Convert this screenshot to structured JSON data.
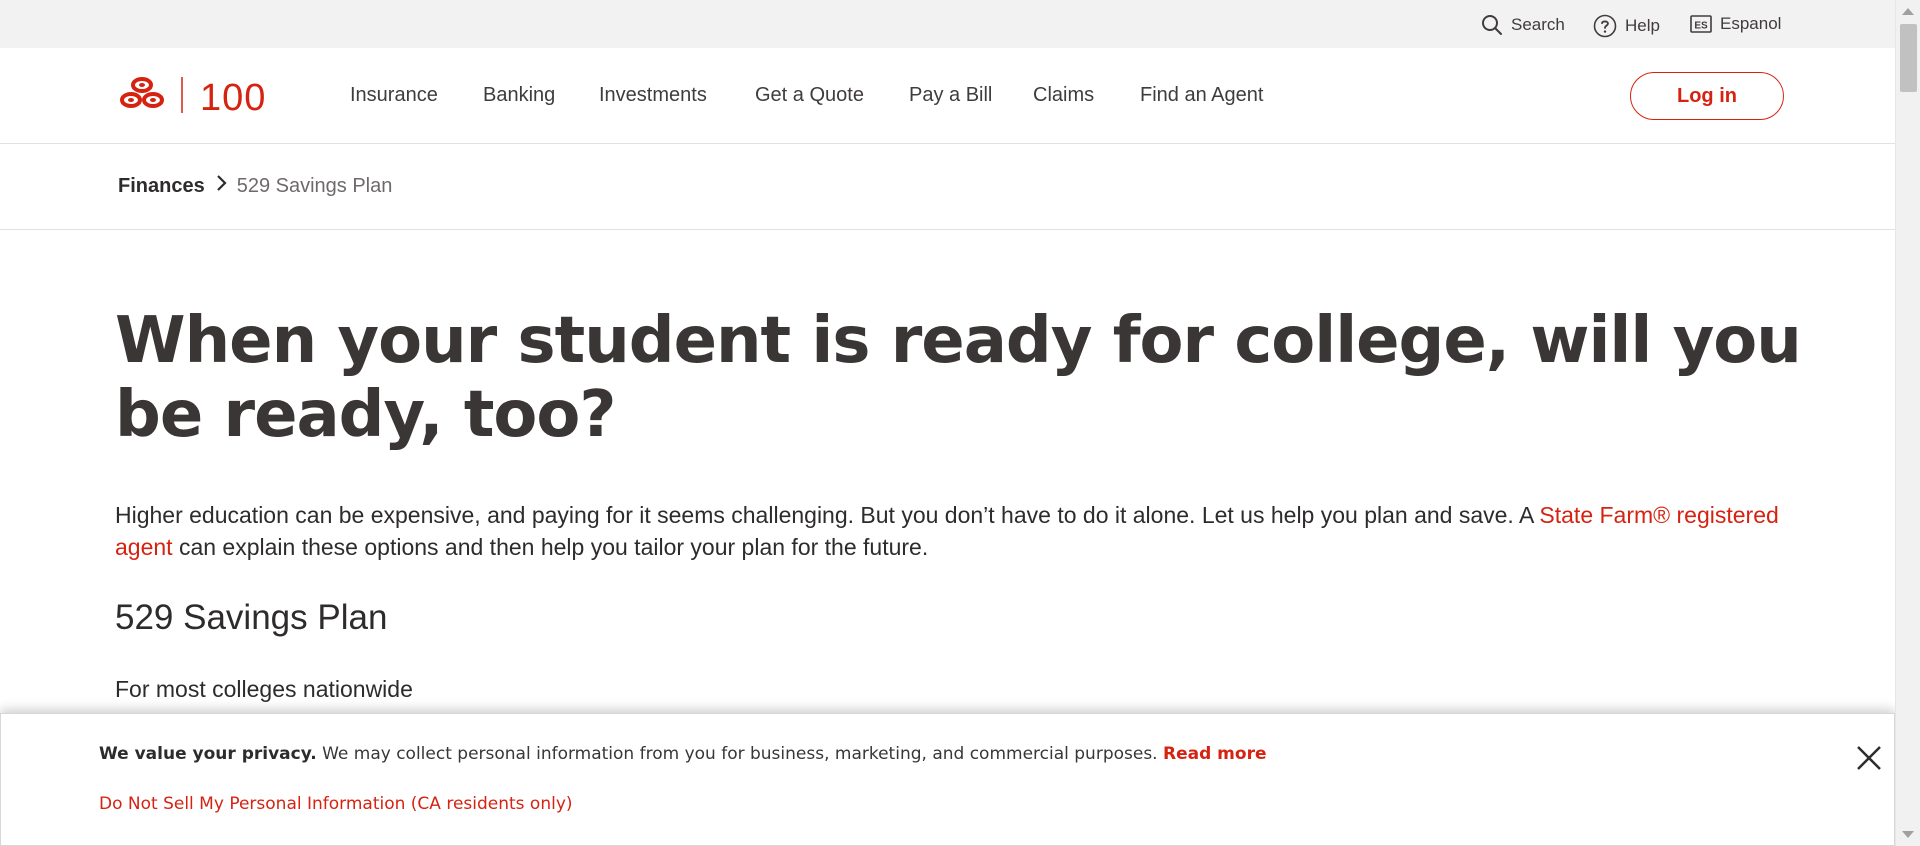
{
  "utility": {
    "search_label": "Search",
    "help_label": "Help",
    "espanol_label": "Espanol",
    "espanol_badge": "ES"
  },
  "logo": {
    "text": "100",
    "brand_color": "#d62311"
  },
  "nav": {
    "items": [
      "Insurance",
      "Banking",
      "Investments",
      "Get a Quote",
      "Pay a Bill",
      "Claims",
      "Find an Agent"
    ],
    "login_label": "Log in"
  },
  "breadcrumb": {
    "parent": "Finances",
    "current": "529 Savings Plan"
  },
  "content": {
    "title": "When your student is ready for college, will you be ready, too?",
    "intro_before": "Higher education can be expensive, and paying for it seems challenging. But you don’t have to do it alone. Let us help you plan and save. A ",
    "intro_link": "State Farm® registered agent",
    "intro_after": " can explain these options and then help you tailor your plan for the future.",
    "section_title": "529 Savings Plan",
    "section_subtitle": "For most colleges nationwide"
  },
  "privacy": {
    "heading": "We value your privacy.",
    "body": " We may collect personal information from you for business, marketing, and commercial purposes. ",
    "read_more": "Read more",
    "do_not_sell": "Do Not Sell My Personal Information (CA residents only)"
  },
  "colors": {
    "accent": "#d62311",
    "text": "#403c3c",
    "utility_bg": "#f3f2f2"
  }
}
